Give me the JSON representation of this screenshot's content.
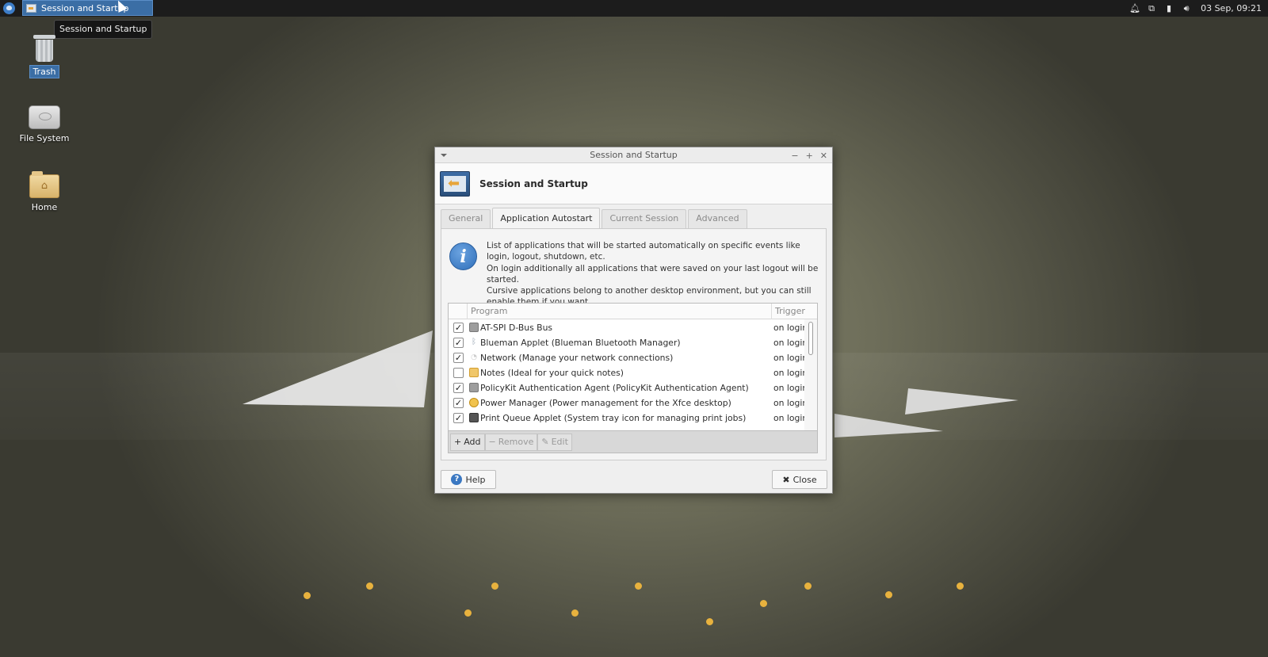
{
  "panel": {
    "task_title": "Session and Startup",
    "clock": "03 Sep, 09:21",
    "tray_icons": [
      "bell-icon",
      "network-icon",
      "battery-icon",
      "volume-icon"
    ]
  },
  "tooltip": "Session and Startup",
  "desktop": {
    "icons": [
      {
        "label": "Trash",
        "icon": "trash-icon"
      },
      {
        "label": "File System",
        "icon": "drive-icon"
      },
      {
        "label": "Home",
        "icon": "home-folder-icon"
      }
    ]
  },
  "window": {
    "title": "Session and Startup",
    "header_title": "Session and Startup",
    "tabs": [
      "General",
      "Application Autostart",
      "Current Session",
      "Advanced"
    ],
    "active_tab": "Application Autostart",
    "info": [
      "List of applications that will be started automatically on specific events like login, logout, shutdown, etc.",
      "On login additionally all applications that were saved on your last logout will be started.",
      "Cursive applications belong to another desktop environment, but you can still enable them if you want."
    ],
    "columns": {
      "program": "Program",
      "trigger": "Trigger"
    },
    "rows": [
      {
        "checked": true,
        "name": "AT-SPI D-Bus Bus",
        "trigger": "on login"
      },
      {
        "checked": true,
        "name": "Blueman Applet (Blueman Bluetooth Manager)",
        "trigger": "on login"
      },
      {
        "checked": true,
        "name": "Network (Manage your network connections)",
        "trigger": "on login"
      },
      {
        "checked": false,
        "name": "Notes (Ideal for your quick notes)",
        "trigger": "on login"
      },
      {
        "checked": true,
        "name": "PolicyKit Authentication Agent (PolicyKit Authentication Agent)",
        "trigger": "on login"
      },
      {
        "checked": true,
        "name": "Power Manager (Power management for the Xfce desktop)",
        "trigger": "on login"
      },
      {
        "checked": true,
        "name": "Print Queue Applet (System tray icon for managing print jobs)",
        "trigger": "on login"
      }
    ],
    "toolbar": {
      "add": "Add",
      "remove": "Remove",
      "edit": "Edit"
    },
    "help_label": "Help",
    "close_label": "Close"
  },
  "colors": {
    "accent": "#3b6ea5",
    "dots": "#e8b23e"
  }
}
